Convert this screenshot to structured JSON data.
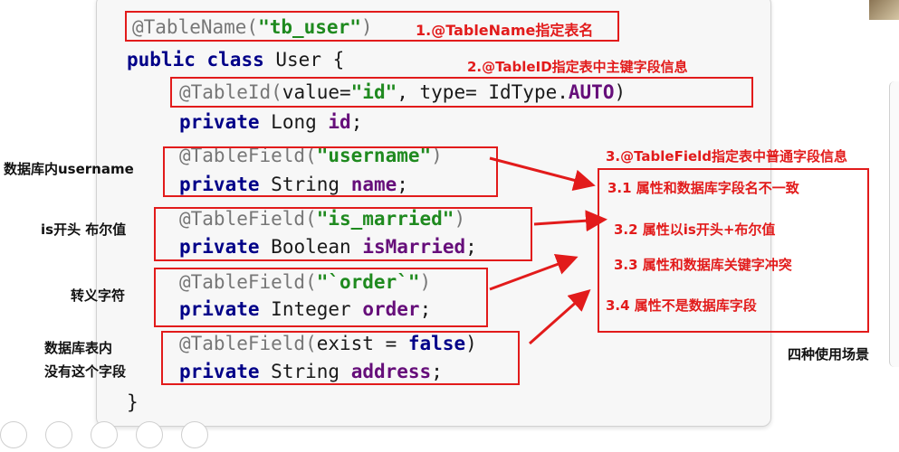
{
  "code": {
    "line1": {
      "anno": "@TableName(",
      "str": "\"tb_user\"",
      "close": ")"
    },
    "line2": {
      "kw1": "public",
      "kw2": "class",
      "rest": "User {"
    },
    "line3": {
      "anno": "@TableId(",
      "param": "value=",
      "str": "\"id\"",
      "mid": ", type= IdType.",
      "enum": "AUTO",
      "close": ")"
    },
    "line4": {
      "kw": "private",
      "type": "Long",
      "field": "id",
      "semi": ";"
    },
    "line5": {
      "anno": "@TableField(",
      "str": "\"username\"",
      "close": ")"
    },
    "line6": {
      "kw": "private",
      "type": "String",
      "field": "name",
      "semi": ";"
    },
    "line7": {
      "anno": "@TableField(",
      "str": "\"is_married\"",
      "close": ")"
    },
    "line8": {
      "kw": "private",
      "type": "Boolean",
      "field": "isMarried",
      "semi": ";"
    },
    "line9": {
      "anno": "@TableField(",
      "str": "\"`order`\"",
      "close": ")"
    },
    "line10": {
      "kw": "private",
      "type": "Integer",
      "field": "order",
      "semi": ";"
    },
    "line11": {
      "anno": "@TableField(",
      "param": "exist = ",
      "kw": "false",
      "close": ")"
    },
    "line12": {
      "kw": "private",
      "type": "String",
      "field": "address",
      "semi": ";"
    },
    "line13": "}"
  },
  "annotations": {
    "label1": "1.@TableName指定表名",
    "label2": "2.@TableID指定表中主键字段信息",
    "label3": "3.@TableField指定表中普通字段信息",
    "sub31": "3.1 属性和数据库字段名不一致",
    "sub32": "3.2 属性以is开头+布尔值",
    "sub33": "3.3 属性和数据库关键字冲突",
    "sub34": "3.4 属性不是数据库字段",
    "scenarios_caption": "四种使用场景"
  },
  "side_labels": {
    "username": "数据库内username",
    "is_bool": "is开头 布尔值",
    "escape": "转义字符",
    "no_field_line1": "数据库表内",
    "no_field_line2": "没有这个字段"
  },
  "colors": {
    "highlight_red": "#e21b1b",
    "annotation_gray": "#777777",
    "string_green": "#1f8a1f",
    "keyword_navy": "#000088",
    "field_purple": "#660e7a"
  }
}
